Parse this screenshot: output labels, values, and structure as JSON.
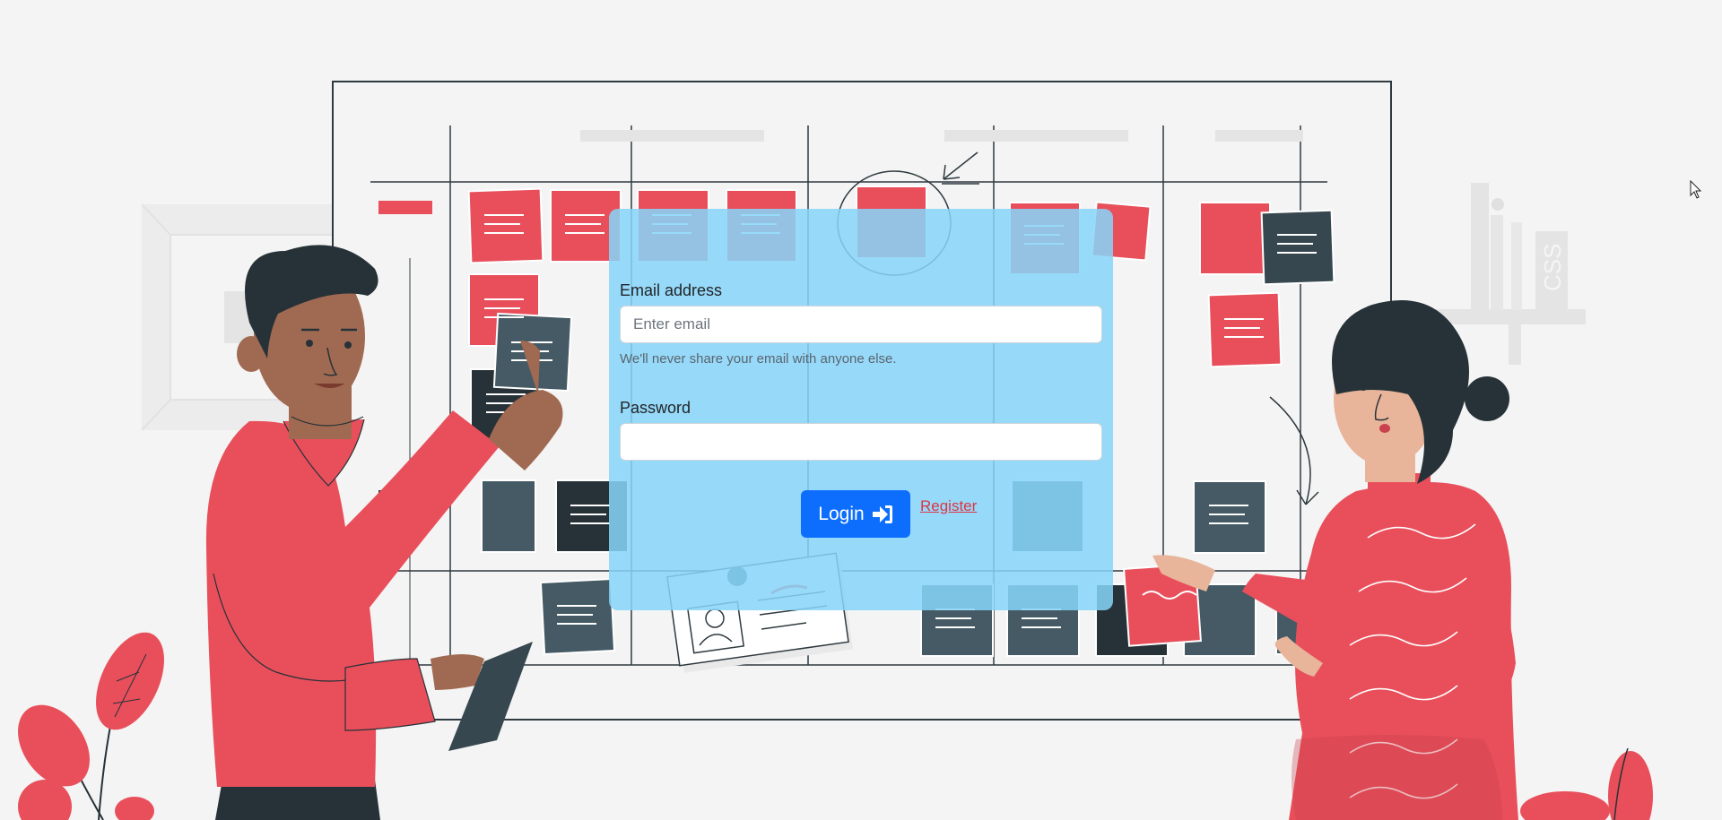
{
  "login_form": {
    "email_label": "Email address",
    "email_placeholder": "Enter email",
    "email_value": "",
    "email_help": "We'll never share your email with anyone else.",
    "password_label": "Password",
    "password_value": "",
    "login_label": "Login",
    "login_icon": "sign-in-icon",
    "register_label": "Register"
  },
  "illustration": {
    "wall_sign_text": "CSS"
  },
  "colors": {
    "card_background": "#87d4f8",
    "primary_button": "#0d6efd",
    "register_link": "#dc3545",
    "sticky_red": "#e84f5b",
    "sticky_dark": "#37474f",
    "background": "#f4f4f4"
  }
}
